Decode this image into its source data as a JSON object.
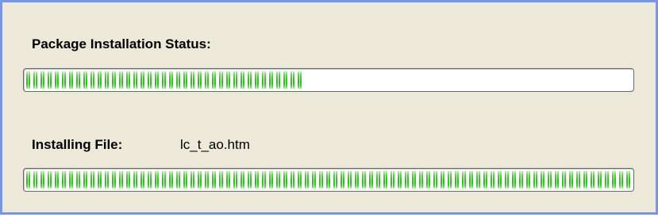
{
  "package": {
    "label": "Package Installation Status:",
    "progress_fraction": 0.455
  },
  "file": {
    "label": "Installing File:",
    "name": "lc_t_ao.htm",
    "progress_fraction": 1.0
  },
  "colors": {
    "panel_background": "#ece9d8",
    "frame_border": "#7a96df",
    "progress_fill": "#2ec21c"
  }
}
